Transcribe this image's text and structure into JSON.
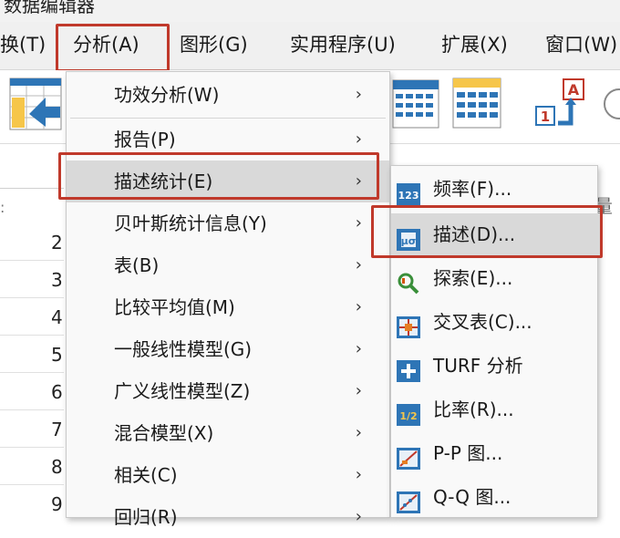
{
  "app": {
    "title": "数据编辑器"
  },
  "menubar": {
    "items": [
      {
        "label": "换(T)"
      },
      {
        "label": "分析(A)"
      },
      {
        "label": "图形(G)"
      },
      {
        "label": "实用程序(U)"
      },
      {
        "label": "扩展(X)"
      },
      {
        "label": "窗口(W)"
      }
    ]
  },
  "toolbar": {
    "icons": [
      "goto-case-icon",
      "variables-grid-icon",
      "dataset-grid-icon",
      "value-labels-icon"
    ],
    "label_icon_letters": {
      "top": "A",
      "bottom": "1"
    }
  },
  "sheet": {
    "rows": [
      "2",
      "3",
      "4",
      "5",
      "6",
      "7",
      "8",
      "9"
    ]
  },
  "analyze_menu": {
    "items": [
      {
        "label": "功效分析(W)",
        "arrow": "›"
      },
      {
        "label": "报告(P)",
        "arrow": "›"
      },
      {
        "label": "描述统计(E)",
        "arrow": "›"
      },
      {
        "label": "贝叶斯统计信息(Y)",
        "arrow": "›"
      },
      {
        "label": "表(B)",
        "arrow": "›"
      },
      {
        "label": "比较平均值(M)",
        "arrow": "›"
      },
      {
        "label": "一般线性模型(G)",
        "arrow": "›"
      },
      {
        "label": "广义线性模型(Z)",
        "arrow": "›"
      },
      {
        "label": "混合模型(X)",
        "arrow": "›"
      },
      {
        "label": "相关(C)",
        "arrow": "›"
      },
      {
        "label": "回归(R)",
        "arrow": "›"
      }
    ]
  },
  "descriptive_submenu": {
    "items": [
      {
        "label": "频率(F)...",
        "icon": "frequencies-icon",
        "icon_text": "123"
      },
      {
        "label": "描述(D)...",
        "icon": "descriptives-icon",
        "icon_text": "μσ"
      },
      {
        "label": "探索(E)...",
        "icon": "explore-icon",
        "icon_text": ""
      },
      {
        "label": "交叉表(C)...",
        "icon": "crosstabs-icon",
        "icon_text": ""
      },
      {
        "label": "TURF 分析",
        "icon": "turf-icon",
        "icon_text": "+"
      },
      {
        "label": "比率(R)...",
        "icon": "ratio-icon",
        "icon_text": "1/2"
      },
      {
        "label": "P-P 图...",
        "icon": "pp-plot-icon",
        "icon_text": ""
      },
      {
        "label": "Q-Q 图...",
        "icon": "qq-plot-icon",
        "icon_text": ""
      }
    ]
  },
  "sheet_header_fragment": "量",
  "colors": {
    "highlight": "#c0392b",
    "active_bg": "#d9d9d9",
    "icon_blue": "#2e75b6"
  }
}
